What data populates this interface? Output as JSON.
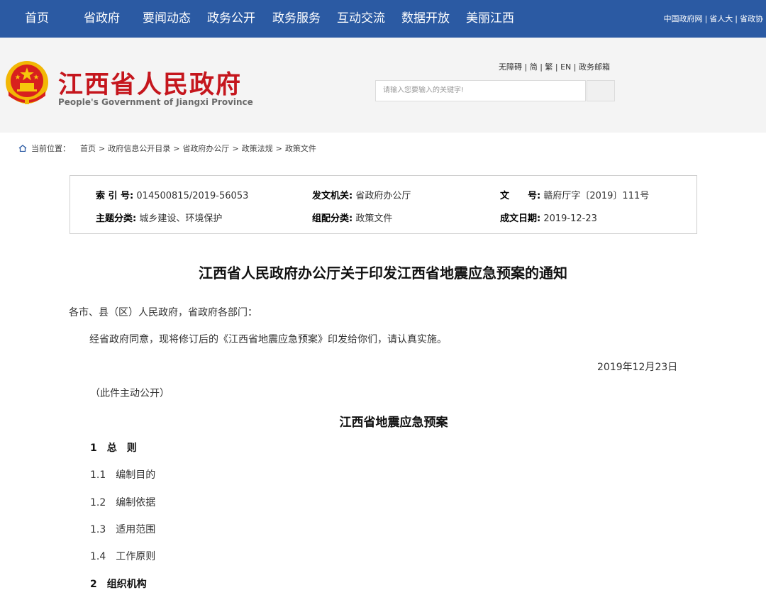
{
  "nav": {
    "items": [
      "首页",
      "省政府",
      "要闻动态",
      "政务公开",
      "政务服务",
      "互动交流",
      "数据开放",
      "美丽江西"
    ],
    "right_links": [
      "中国政府网",
      "省人大",
      "省政协"
    ]
  },
  "header": {
    "site_name_cn": "江西省人民政府",
    "site_name_en": "People's Government of Jiangxi Province",
    "util_links": [
      "无障碍",
      "简",
      "繁",
      "EN",
      "政务邮箱"
    ],
    "search_placeholder": "请输入您要输入的关键字!"
  },
  "breadcrumb": {
    "label": "当前位置：",
    "items": [
      "首页",
      "政府信息公开目录",
      "省政府办公厅",
      "政策法规",
      "政策文件"
    ]
  },
  "meta": {
    "index_label": "索 引 号:",
    "index_value": "014500815/2019-56053",
    "issuer_label": "发文机关:",
    "issuer_value": "省政府办公厅",
    "doc_no_label": "文　　号:",
    "doc_no_value": "赣府厅字〔2019〕111号",
    "topic_label": "主题分类:",
    "topic_value": "城乡建设、环境保护",
    "category_label": "组配分类:",
    "category_value": "政策文件",
    "date_label": "成文日期:",
    "date_value": "2019-12-23"
  },
  "article": {
    "title": "江西省人民政府办公厅关于印发江西省地震应急预案的通知",
    "salutation": "各市、县（区）人民政府，省政府各部门：",
    "body": "经省政府同意，现将修订后的《江西省地震应急预案》印发给你们，请认真实施。",
    "date": "2019年12月23日",
    "note": "（此件主动公开）",
    "plan_title": "江西省地震应急预案",
    "sections": [
      {
        "text": "1　总　则",
        "bold": true
      },
      {
        "text": "1.1　编制目的",
        "bold": false
      },
      {
        "text": "1.2　编制依据",
        "bold": false
      },
      {
        "text": "1.3　适用范围",
        "bold": false
      },
      {
        "text": "1.4　工作原则",
        "bold": false
      },
      {
        "text": "2　组织机构",
        "bold": true
      }
    ]
  },
  "colors": {
    "nav_bg": "#2b5aa3",
    "brand_red": "#c5161d",
    "emblem_gold": "#f2b705"
  }
}
